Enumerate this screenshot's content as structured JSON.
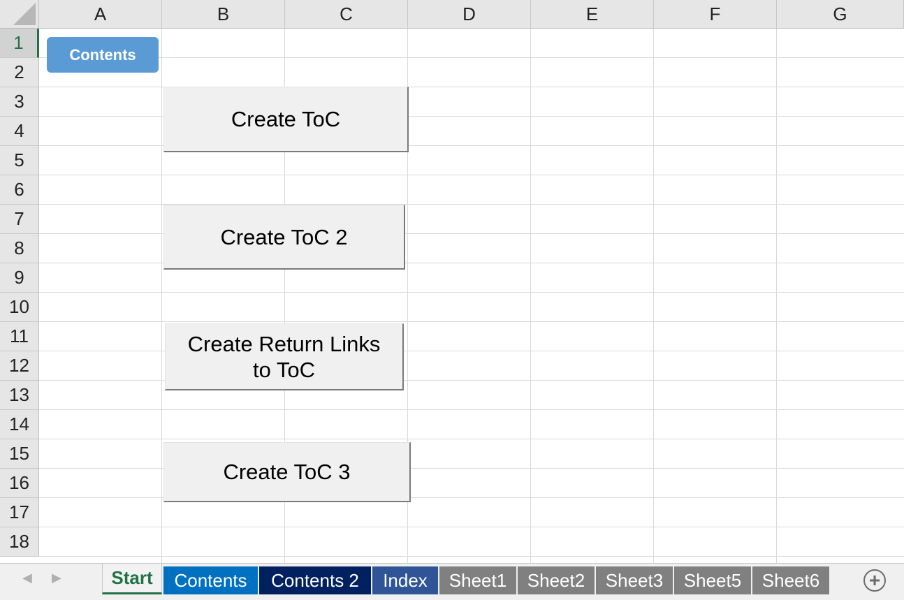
{
  "columns": [
    "A",
    "B",
    "C",
    "D",
    "E",
    "F",
    "G"
  ],
  "rows": [
    "1",
    "2",
    "3",
    "4",
    "5",
    "6",
    "7",
    "8",
    "9",
    "10",
    "11",
    "12",
    "13",
    "14",
    "15",
    "16",
    "17",
    "18"
  ],
  "shapes": {
    "contents_label": "Contents"
  },
  "buttons": {
    "create_toc": "Create ToC",
    "create_toc_2": "Create ToC 2",
    "create_return_links_line1": "Create Return Links",
    "create_return_links_line2": "to ToC",
    "create_toc_3": "Create ToC 3"
  },
  "tabs": [
    {
      "label": "Start",
      "active": true,
      "color": "#f2f2f2",
      "text_color": "#217346"
    },
    {
      "label": "Contents",
      "color": "#0070c0",
      "text_color": "#ffffff"
    },
    {
      "label": "Contents 2",
      "color": "#002060",
      "text_color": "#ffffff"
    },
    {
      "label": "Index",
      "color": "#2f5597",
      "text_color": "#ffffff"
    },
    {
      "label": "Sheet1",
      "color": "#808080",
      "text_color": "#ffffff"
    },
    {
      "label": "Sheet2",
      "color": "#808080",
      "text_color": "#ffffff"
    },
    {
      "label": "Sheet3",
      "color": "#808080",
      "text_color": "#ffffff"
    },
    {
      "label": "Sheet5",
      "color": "#808080",
      "text_color": "#ffffff"
    },
    {
      "label": "Sheet6",
      "color": "#808080",
      "text_color": "#ffffff"
    }
  ],
  "icons": {
    "nav_prev": "chevron-left-icon",
    "nav_next": "chevron-right-icon",
    "add_sheet": "plus-circle-icon"
  },
  "theme": {
    "excel_green": "#217346",
    "shape_blue": "#5b9bd5"
  }
}
